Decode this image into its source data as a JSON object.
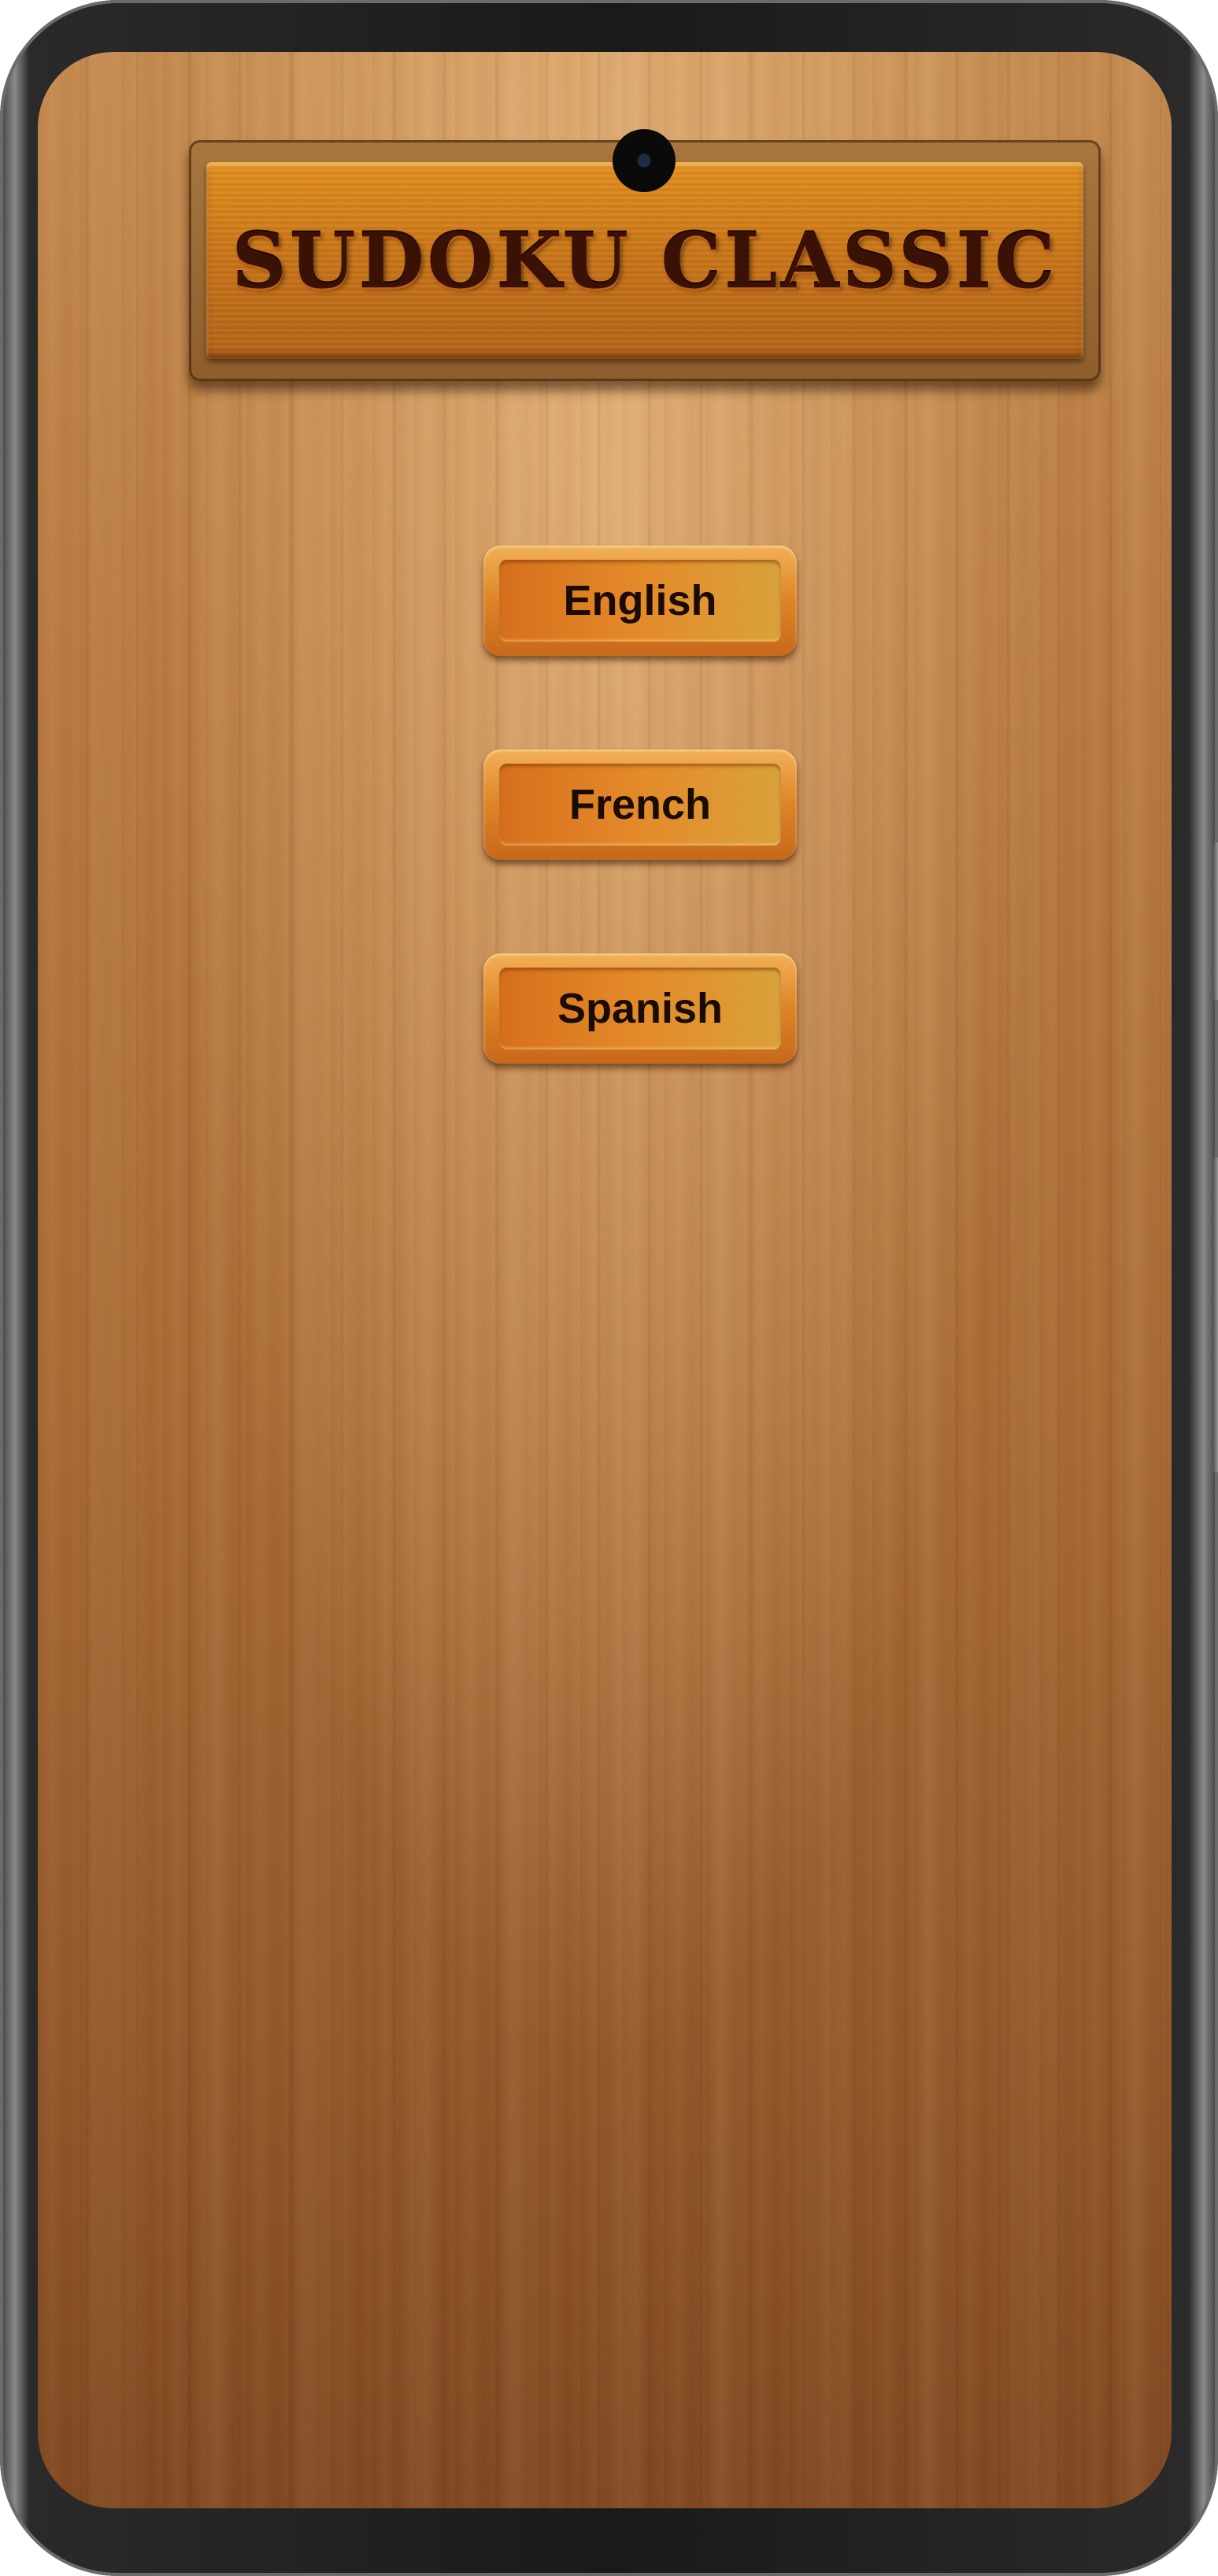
{
  "app": {
    "title": "SUDOKU CLASSIC"
  },
  "language_menu": {
    "options": [
      {
        "label": "English"
      },
      {
        "label": "French"
      },
      {
        "label": "Spanish"
      }
    ]
  },
  "colors": {
    "wood_background": "#b87a41",
    "title_board": "#c9761a",
    "button_face": "#e48a2a",
    "text_dark": "#1a0c04"
  }
}
